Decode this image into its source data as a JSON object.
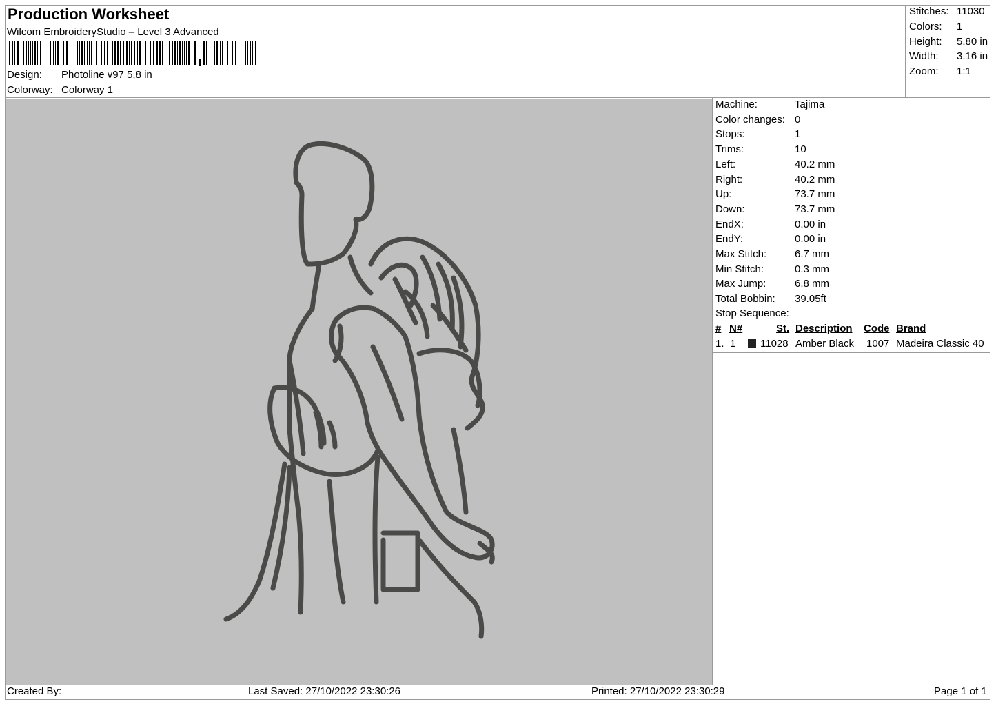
{
  "header": {
    "title": "Production Worksheet",
    "software": "Wilcom EmbroideryStudio – Level 3 Advanced",
    "design_label": "Design:",
    "design_value": "Photoline v97 5,8 in",
    "colorway_label": "Colorway:",
    "colorway_value": "Colorway 1"
  },
  "stats": [
    {
      "label": "Stitches:",
      "value": "11030"
    },
    {
      "label": "Colors:",
      "value": "1"
    },
    {
      "label": "Height:",
      "value": "5.80 in"
    },
    {
      "label": "Width:",
      "value": "3.16 in"
    },
    {
      "label": "Zoom:",
      "value": "1:1"
    }
  ],
  "details": [
    {
      "label": "Machine:",
      "value": "Tajima"
    },
    {
      "label": "Color changes:",
      "value": "0"
    },
    {
      "label": "Stops:",
      "value": "1"
    },
    {
      "label": "Trims:",
      "value": "10"
    },
    {
      "label": "Left:",
      "value": "40.2 mm"
    },
    {
      "label": "Right:",
      "value": "40.2 mm"
    },
    {
      "label": "Up:",
      "value": "73.7 mm"
    },
    {
      "label": "Down:",
      "value": "73.7 mm"
    },
    {
      "label": "EndX:",
      "value": "0.00 in"
    },
    {
      "label": "EndY:",
      "value": "0.00 in"
    },
    {
      "label": "Max Stitch:",
      "value": "6.7 mm"
    },
    {
      "label": "Min Stitch:",
      "value": "0.3 mm"
    },
    {
      "label": "Max Jump:",
      "value": "6.8 mm"
    },
    {
      "label": "Total Bobbin:",
      "value": "39.05ft"
    }
  ],
  "stop_sequence": {
    "title": "Stop Sequence:",
    "columns": {
      "num": "#",
      "needle": "N#",
      "stitches": "St.",
      "description": "Description",
      "code": "Code",
      "brand": "Brand"
    },
    "rows": [
      {
        "num": "1.",
        "needle": "1",
        "color": "#222222",
        "stitches": "11028",
        "description": "Amber Black",
        "code": "1007",
        "brand": "Madeira Classic 40"
      }
    ]
  },
  "footer": {
    "created_by": "Created By:",
    "last_saved": "Last Saved: 27/10/2022 23:30:26",
    "printed": "Printed: 27/10/2022 23:30:29",
    "page": "Page 1 of 1"
  },
  "colors": {
    "preview_background": "#c0c0c0",
    "thread": "#4a4a48"
  }
}
